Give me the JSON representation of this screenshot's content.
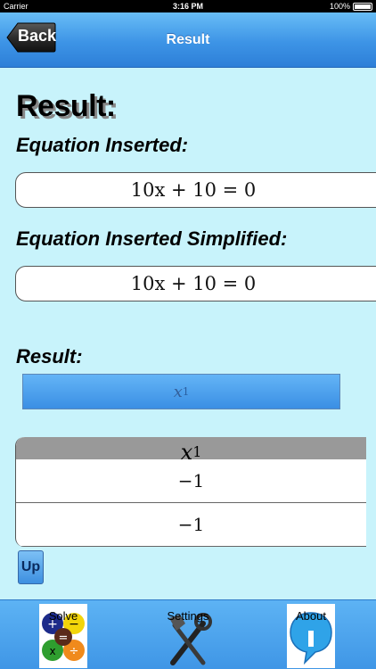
{
  "status": {
    "carrier": "Carrier",
    "time": "3:16 PM",
    "battery": "100%"
  },
  "nav": {
    "back_label": "Back",
    "title": "Result"
  },
  "main_title": "Result:",
  "section1": {
    "label": "Equation Inserted:",
    "equation": "10x + 10 = 0"
  },
  "section2": {
    "label": "Equation Inserted Simplified:",
    "equation": "10x + 10 = 0"
  },
  "result": {
    "label": "Result:",
    "variable": "x",
    "subscript": "1"
  },
  "table": {
    "header": {
      "variable": "x",
      "subscript": "1"
    },
    "rows": [
      "−1",
      "−1"
    ]
  },
  "up_label": "Up",
  "tabs": [
    {
      "label": "Solve",
      "icon": "solve-icon"
    },
    {
      "label": "Settings",
      "icon": "tools-icon"
    },
    {
      "label": "About",
      "icon": "info-icon"
    }
  ],
  "colors": {
    "background": "#c8f3fb",
    "bar": "#3d94e6",
    "table_header": "#999999"
  }
}
